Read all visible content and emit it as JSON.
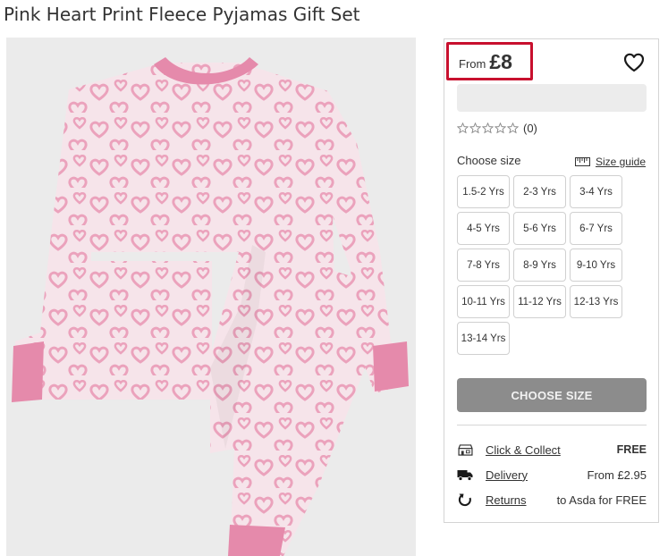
{
  "product": {
    "title": "Pink Heart Print Fleece Pyjamas Gift Set",
    "image_alt": "product-image"
  },
  "price": {
    "from_label": "From",
    "value": "£8"
  },
  "icons": {
    "wishlist": "heart-outline-icon",
    "size_guide": "ruler-icon",
    "click_collect": "shop-icon",
    "delivery": "truck-icon",
    "returns": "return-arrow-icon"
  },
  "rating": {
    "stars_filled": 0,
    "stars_total": 5,
    "count": "(0)"
  },
  "sizes": {
    "label": "Choose size",
    "guide_label": "Size guide",
    "options": [
      "1.5-2 Yrs",
      "2-3 Yrs",
      "3-4 Yrs",
      "4-5 Yrs",
      "5-6 Yrs",
      "6-7 Yrs",
      "7-8 Yrs",
      "8-9 Yrs",
      "9-10 Yrs",
      "10-11 Yrs",
      "11-12 Yrs",
      "12-13 Yrs",
      "13-14 Yrs"
    ]
  },
  "cta": {
    "label": "CHOOSE SIZE"
  },
  "fulfilment": {
    "click_collect": {
      "label": "Click & Collect",
      "value": "FREE"
    },
    "delivery": {
      "label": "Delivery",
      "value": "From £2.95"
    },
    "returns": {
      "label": "Returns",
      "value": "to Asda for FREE"
    }
  },
  "colors": {
    "accent_border": "#c8102e",
    "button_disabled": "#8c8c8c",
    "pink_light": "#f3d9e2",
    "pink_dark": "#e58aab"
  }
}
